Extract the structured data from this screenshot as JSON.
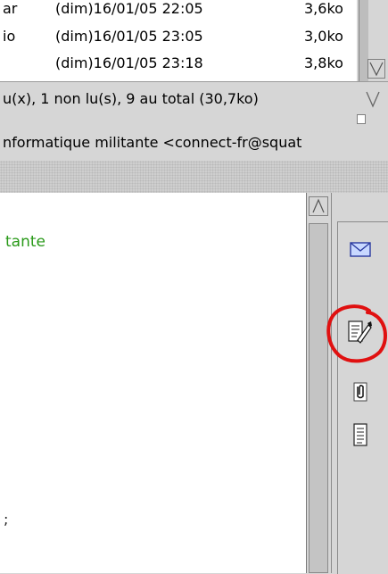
{
  "message_list": {
    "rows": [
      {
        "sender": "ar",
        "date": "(dim)16/01/05 22:05",
        "size": "3,6ko"
      },
      {
        "sender": "io",
        "date": "(dim)16/01/05 23:05",
        "size": "3,0ko"
      },
      {
        "sender": "",
        "date": "(dim)16/01/05 23:18",
        "size": "3,8ko"
      }
    ]
  },
  "status_bar": {
    "text": "u(x), 1 non lu(s), 9 au total (30,7ko)"
  },
  "header": {
    "from": "nformatique militante <connect-fr@squat"
  },
  "body": {
    "line_1": "tante",
    "fragment": ";"
  },
  "toolbar": {
    "buttons": [
      "mail-icon",
      "compose-icon",
      "attachment-icon",
      "text-document-icon"
    ]
  },
  "colors": {
    "body_text_green": "#2a9a1a",
    "highlight_red": "#e01010",
    "panel_gray": "#d6d6d6"
  }
}
